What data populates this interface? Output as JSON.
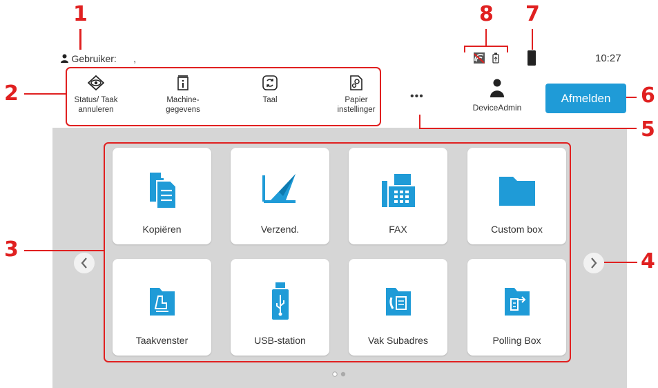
{
  "header": {
    "user_label": "Gebruiker:",
    "user_value": ",",
    "time": "10:27",
    "account_name": "DeviceAdmin",
    "logout_label": "Afmelden",
    "more_label": "•••"
  },
  "system_menu": [
    {
      "line1": "Status/ Taak",
      "line2": "annuleren",
      "icon": "eye-icon"
    },
    {
      "line1": "Machine-",
      "line2": "gegevens",
      "icon": "info-icon"
    },
    {
      "line1": "Taal",
      "line2": "",
      "icon": "language-icon"
    },
    {
      "line1": "Papier",
      "line2": "instellinger",
      "icon": "paper-settings-icon"
    }
  ],
  "tiles": [
    {
      "label": "Kopiëren",
      "icon": "copy-icon"
    },
    {
      "label": "Verzend.",
      "icon": "send-icon"
    },
    {
      "label": "FAX",
      "icon": "fax-icon"
    },
    {
      "label": "Custom box",
      "icon": "folder-icon"
    },
    {
      "label": "Taakvenster",
      "icon": "job-box-icon"
    },
    {
      "label": "USB-station",
      "icon": "usb-icon"
    },
    {
      "label": "Vak Subadres",
      "icon": "subaddress-box-icon"
    },
    {
      "label": "Polling Box",
      "icon": "polling-box-icon"
    }
  ],
  "pagination": {
    "pages": 2,
    "current": 1
  },
  "callouts": [
    "1",
    "2",
    "3",
    "4",
    "5",
    "6",
    "7",
    "8"
  ],
  "colors": {
    "accent": "#1f9bd7",
    "annotation": "#e02020",
    "panel": "#d6d6d6"
  }
}
